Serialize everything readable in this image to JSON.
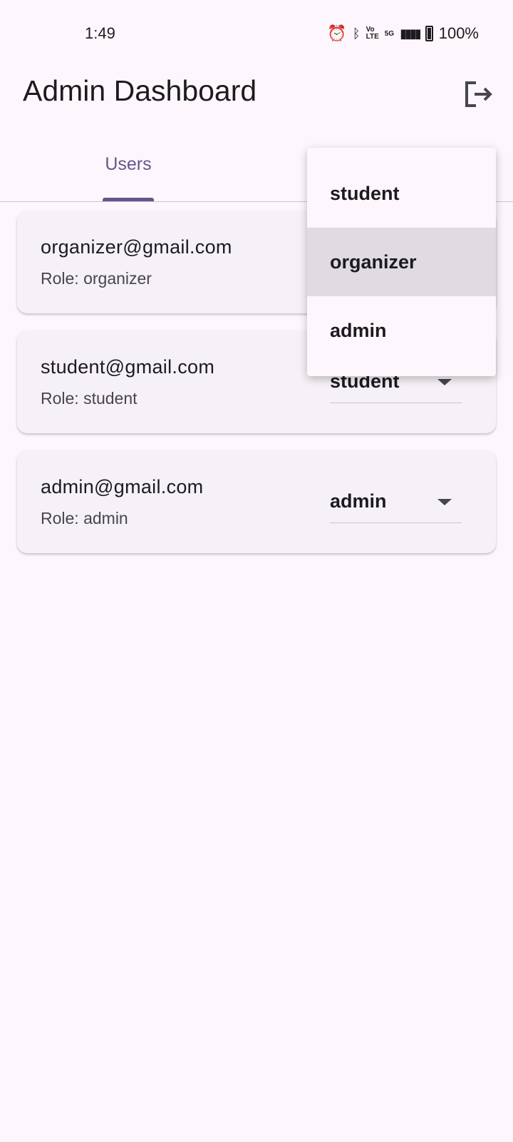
{
  "status_bar": {
    "time": "1:49",
    "battery": "100%",
    "network": "5G"
  },
  "app_bar": {
    "title": "Admin Dashboard"
  },
  "tabs": [
    {
      "label": "Users",
      "selected": true
    }
  ],
  "users": [
    {
      "email": "organizer@gmail.com",
      "role_text": "Role: organizer",
      "role": "organizer"
    },
    {
      "email": "student@gmail.com",
      "role_text": "Role: student",
      "role": "student"
    },
    {
      "email": "admin@gmail.com",
      "role_text": "Role: admin",
      "role": "admin"
    }
  ],
  "role_menu": {
    "options": [
      "student",
      "organizer",
      "admin"
    ],
    "highlighted": "organizer"
  },
  "colors": {
    "accent": "#65558f",
    "background": "#fdf7fd",
    "card": "#f5f1f6"
  }
}
